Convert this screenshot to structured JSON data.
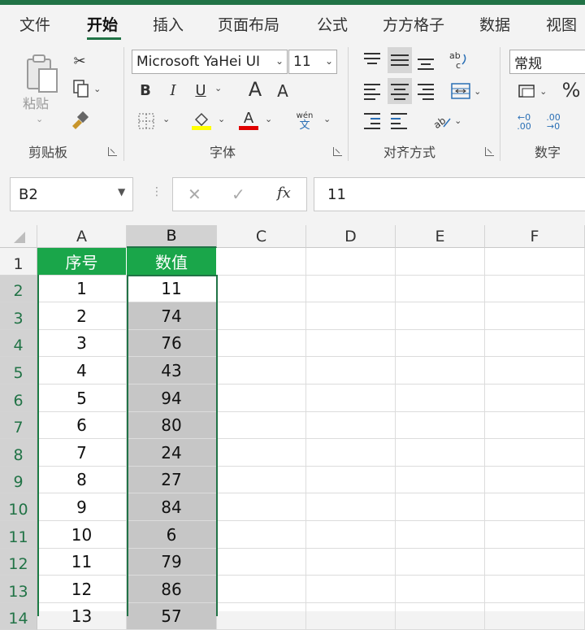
{
  "tabs": [
    "文件",
    "开始",
    "插入",
    "页面布局",
    "公式",
    "方方格子",
    "数据",
    "视图"
  ],
  "ribbon": {
    "clipboard": {
      "paste_label": "粘贴",
      "group_label": "剪贴板"
    },
    "font": {
      "font_name": "Microsoft YaHei UI",
      "font_size": "11",
      "bold": "B",
      "italic": "I",
      "underline": "U",
      "grow": "A",
      "shrink": "A",
      "font_color_glyph": "A",
      "phonetic_top": "wén",
      "phonetic_bottom": "文",
      "group_label": "字体"
    },
    "alignment": {
      "group_label": "对齐方式"
    },
    "number": {
      "format": "常规",
      "percent": "%",
      "inc_decimal": "←0\n.00",
      "dec_decimal": ".00\n→0",
      "group_label": "数字"
    },
    "colors": {
      "accent": "#217346",
      "fill_highlight": "#ffff00",
      "font_color": "#e00000"
    }
  },
  "formula_bar": {
    "name_box": "B2",
    "cancel": "✕",
    "enter": "✓",
    "fx": "fx",
    "content": "11"
  },
  "grid": {
    "columns": [
      "A",
      "B",
      "C",
      "D",
      "E",
      "F"
    ],
    "rows": [
      "1",
      "2",
      "3",
      "4",
      "5",
      "6",
      "7",
      "8",
      "9",
      "10",
      "11",
      "12",
      "13",
      "14"
    ],
    "header": [
      "序号",
      "数值"
    ],
    "col_a": [
      "1",
      "2",
      "3",
      "4",
      "5",
      "6",
      "7",
      "8",
      "9",
      "10",
      "11",
      "12",
      "13"
    ],
    "col_b": [
      "11",
      "74",
      "76",
      "43",
      "94",
      "80",
      "24",
      "27",
      "84",
      "6",
      "79",
      "86",
      "57"
    ]
  }
}
